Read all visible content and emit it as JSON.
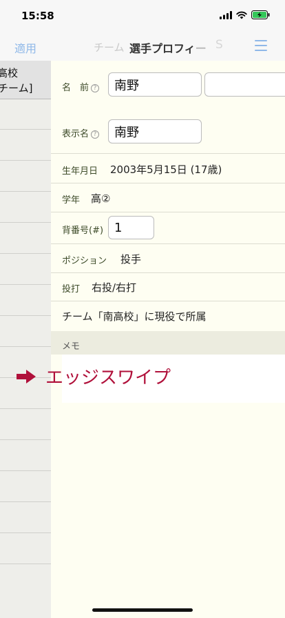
{
  "status_bar": {
    "time": "15:58",
    "icons": [
      "signal-icon",
      "wifi-icon",
      "battery-charging-icon"
    ],
    "battery_color": "#34c759"
  },
  "nav": {
    "left_label": "適用",
    "ghost_left": "チーム",
    "title": "選手プロフィ",
    "title_fade": "ー",
    "ghost_right": "S",
    "menu_icon": "menu-icon",
    "accent_color": "#8fb8e8"
  },
  "back_list": {
    "header_line1": "高校",
    "header_line2": "/チーム]"
  },
  "profile": {
    "name_label": "名　前",
    "name_value": "南野",
    "name_value2": "",
    "display_label": "表示名",
    "display_value": "南野",
    "birth_label": "生年月日",
    "birth_value": "2003年5月15日 (17歳)",
    "grade_label": "学年",
    "grade_value": "高②",
    "number_label": "背番号(#)",
    "number_value": "1",
    "position_label": "ポジション",
    "position_value": "投手",
    "bat_label": "投打",
    "bat_value": "右投/右打",
    "team_status": "チーム「南高校」に現役で所属",
    "memo_label": "メモ",
    "help_glyph": "?"
  },
  "annotation": {
    "text": "エッジスワイプ",
    "color": "#b0103a",
    "icon": "arrow-right-icon"
  }
}
